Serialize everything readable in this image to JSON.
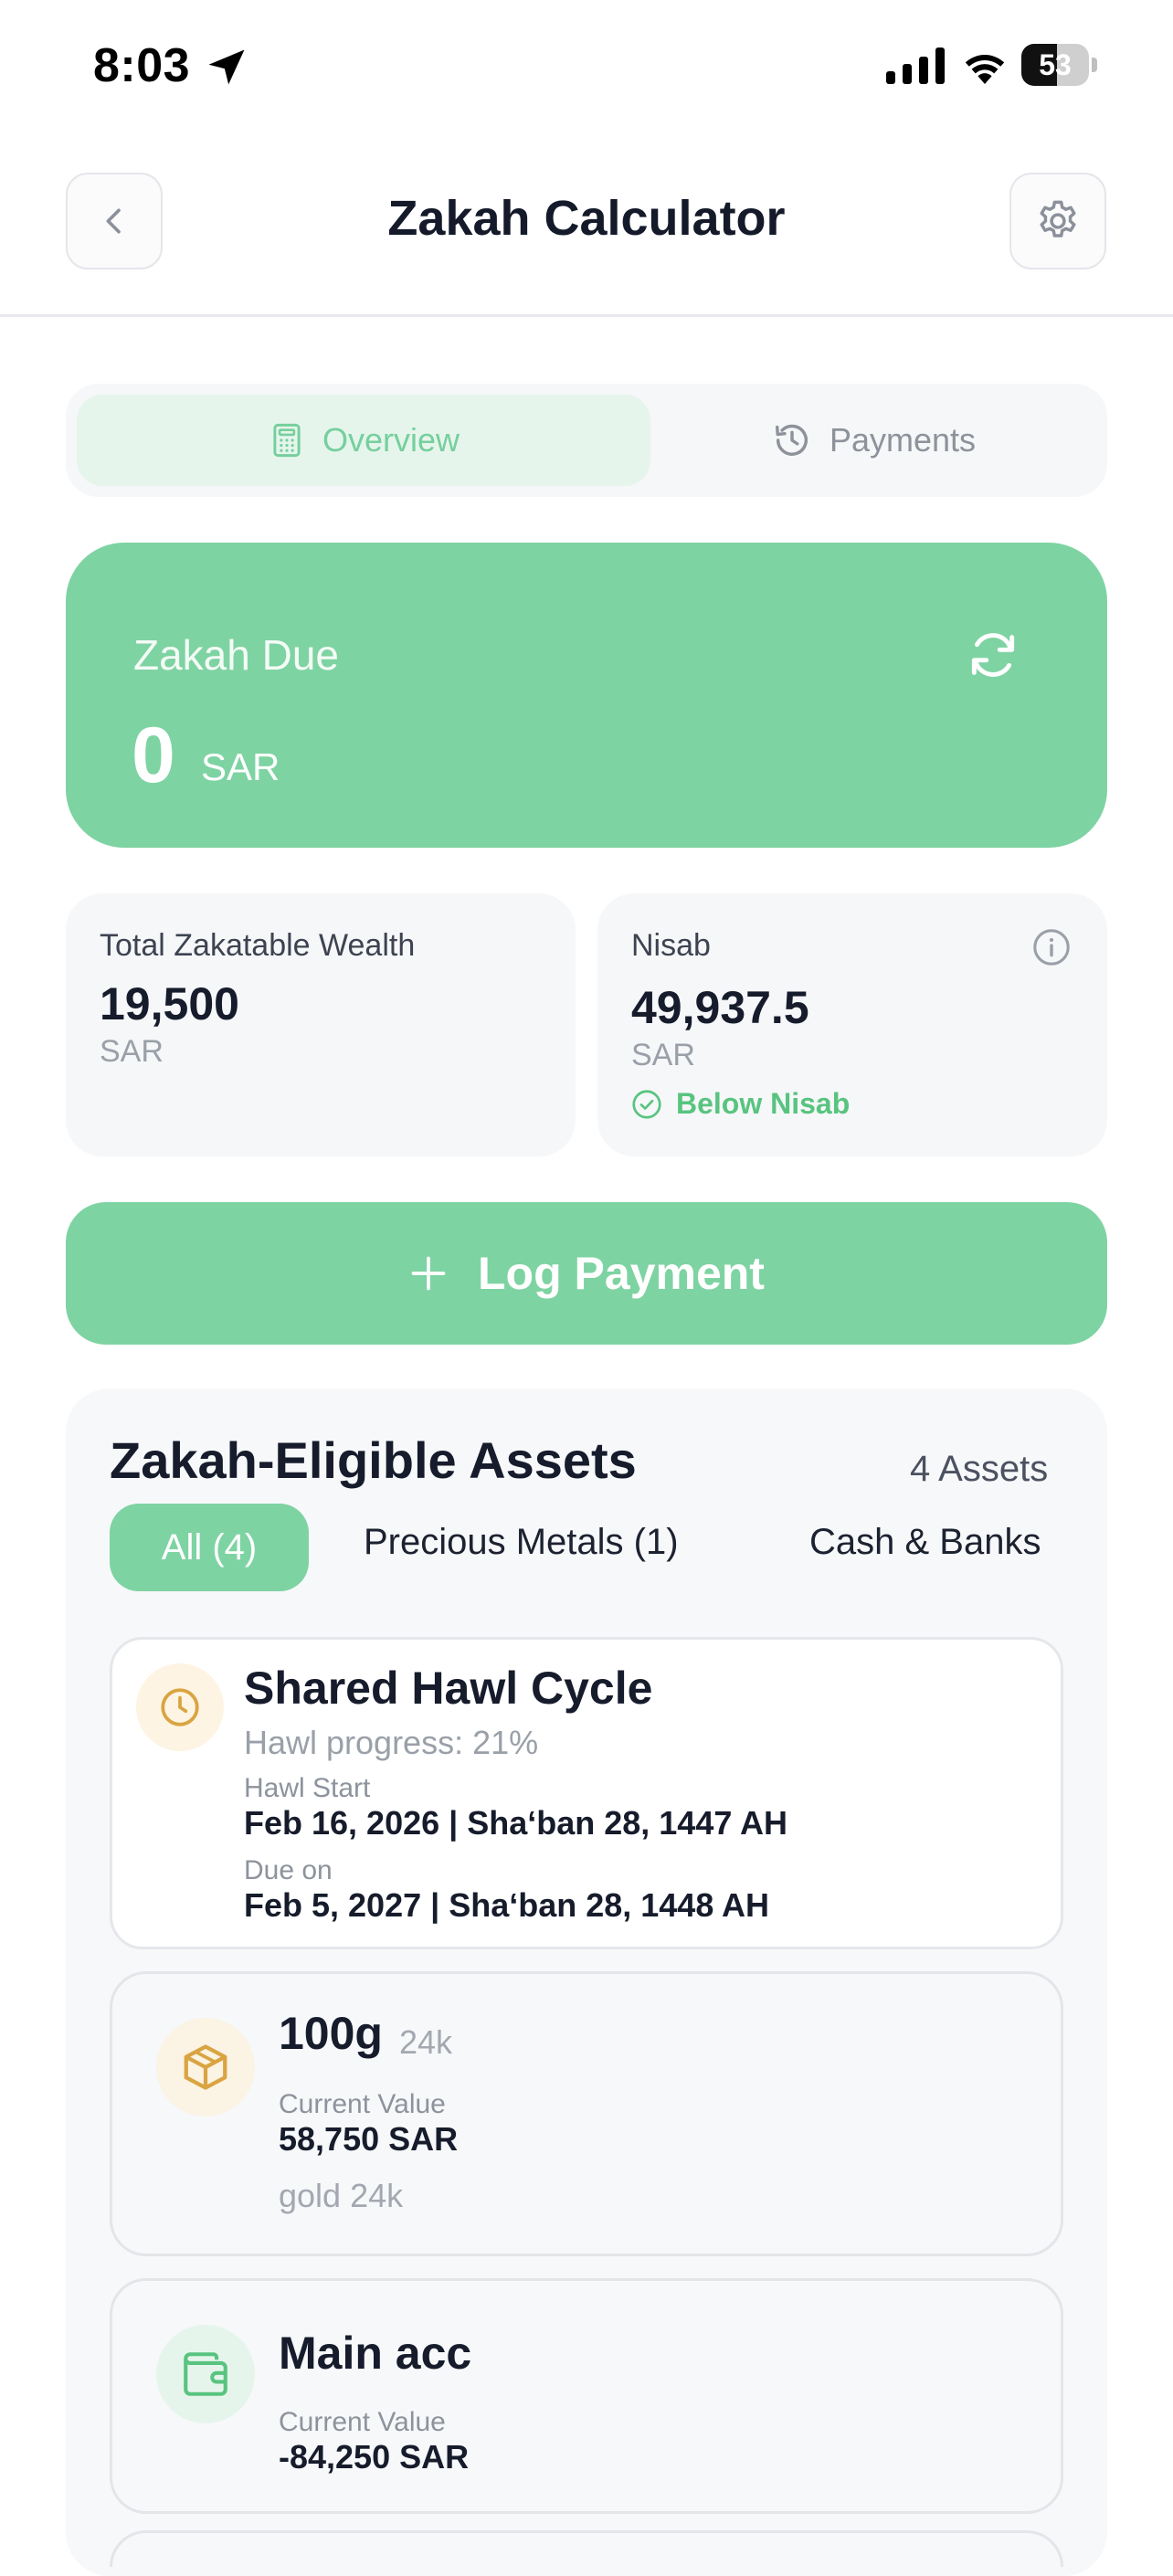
{
  "status_bar": {
    "time": "8:03",
    "battery": "53",
    "battery_level": 0.53
  },
  "header": {
    "title": "Zakah Calculator"
  },
  "tabs": [
    {
      "label": "Overview",
      "active": true
    },
    {
      "label": "Payments",
      "active": false
    }
  ],
  "zakah_due": {
    "label": "Zakah Due",
    "value": "0",
    "currency": "SAR"
  },
  "wealth": {
    "label": "Total Zakatable Wealth",
    "value": "19,500",
    "currency": "SAR"
  },
  "nisab": {
    "label": "Nisab",
    "value": "49,937.5",
    "currency": "SAR",
    "status": "Below Nisab"
  },
  "log_payment": {
    "label": "Log Payment"
  },
  "assets": {
    "title": "Zakah-Eligible Assets",
    "count": "4 Assets",
    "filters": [
      "All (4)",
      "Precious Metals (1)",
      "Cash & Banks"
    ],
    "hawl": {
      "title": "Shared Hawl Cycle",
      "progress": "Hawl progress: 21%",
      "start_label": "Hawl Start",
      "start_value": "Feb 16, 2026 | Sha‘ban 28, 1447 AH",
      "due_label": "Due on",
      "due_value": "Feb 5, 2027 | Sha‘ban 28, 1448 AH"
    },
    "items": [
      {
        "name": "100g",
        "tag": "24k",
        "value_label": "Current Value",
        "value": "58,750 SAR",
        "note": "gold 24k"
      },
      {
        "name": "Main acc",
        "value_label": "Current Value",
        "value": "-84,250 SAR"
      }
    ]
  },
  "colors": {
    "accent": "#7ed3a2",
    "accent_text": "#58c47f",
    "gold": "#d9a441",
    "muted": "#9aa0a8"
  }
}
